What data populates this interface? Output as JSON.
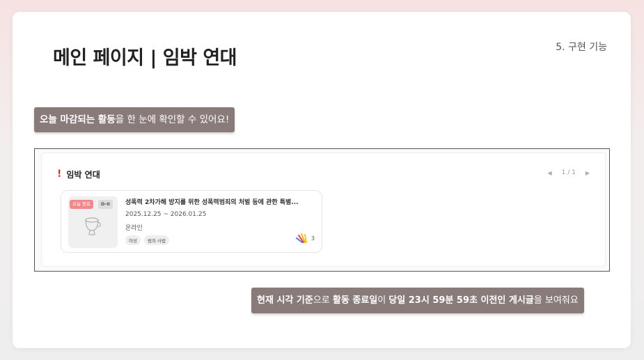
{
  "page": {
    "title": "메인 페이지 | 임박 연대",
    "section": "5. 구현 기능"
  },
  "callouts": {
    "top": {
      "bold": "오늘 마감되는 활동",
      "rest": "을 한 눈에 확인할 수 있어요!"
    },
    "bottom": {
      "b1": "현재 시각 기준",
      "t1": "으로 ",
      "b2": "활동 종료일",
      "t2": "이 ",
      "b3": "당일 23시 59분 59초 이전인 게시글",
      "t3": "을 보여줘요"
    }
  },
  "widget": {
    "alert_mark": "!",
    "title": "임박 연대",
    "pager": {
      "prev_icon": "◀",
      "text": "1 / 1",
      "next_icon": "▶"
    },
    "card": {
      "badge_today": "오늘 종료",
      "badge_dday": "D-0",
      "title": "성폭력 2차가해 방지를 위한 성폭력범죄의 처벌 등에 관한 특별...",
      "date_range": "2025.12.25 ~ 2026.01.25",
      "mode": "온라인",
      "tags": [
        "여성",
        "범죄·사법"
      ],
      "like_count": "3",
      "thumbnail_icon": "cup-icon",
      "like_icon": "solidarity-hands-icon"
    }
  },
  "colors": {
    "callout_bg": "#8a7b7b",
    "badge_today": "#f08a8a",
    "alert": "#e03131"
  }
}
